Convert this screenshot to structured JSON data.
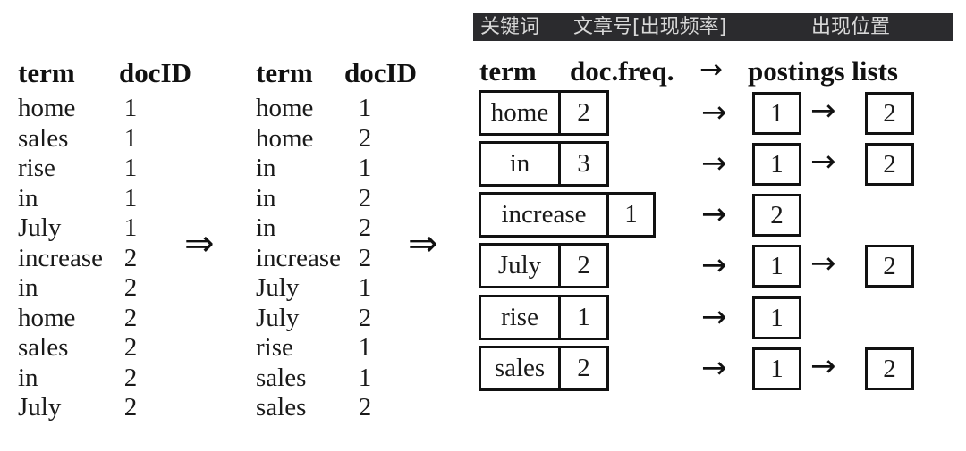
{
  "cn_header": {
    "keyword_label": "关键词",
    "docfreq_label": "文章号[出现频率]",
    "position_label": "出现位置"
  },
  "table1": {
    "headers": [
      "term",
      "docID"
    ],
    "rows": [
      [
        "home",
        "1"
      ],
      [
        "sales",
        "1"
      ],
      [
        "rise",
        "1"
      ],
      [
        "in",
        "1"
      ],
      [
        "July",
        "1"
      ],
      [
        "increase",
        "2"
      ],
      [
        "in",
        "2"
      ],
      [
        "home",
        "2"
      ],
      [
        "sales",
        "2"
      ],
      [
        "in",
        "2"
      ],
      [
        "July",
        "2"
      ]
    ]
  },
  "transform_arrow": "⇒",
  "table2": {
    "headers": [
      "term",
      "docID"
    ],
    "rows": [
      [
        "home",
        "1"
      ],
      [
        "home",
        "2"
      ],
      [
        "in",
        "1"
      ],
      [
        "in",
        "2"
      ],
      [
        "in",
        "2"
      ],
      [
        "increase",
        "2"
      ],
      [
        "July",
        "1"
      ],
      [
        "July",
        "2"
      ],
      [
        "rise",
        "1"
      ],
      [
        "sales",
        "1"
      ],
      [
        "sales",
        "2"
      ]
    ]
  },
  "index": {
    "header_term": "term",
    "header_docfreq": "doc.freq.",
    "header_arrow": "→",
    "header_postings": "postings lists",
    "pointer_arrow": "→",
    "entries": [
      {
        "term": "home",
        "freq": "2",
        "postings": [
          "1",
          "2"
        ]
      },
      {
        "term": "in",
        "freq": "3",
        "postings": [
          "1",
          "2"
        ]
      },
      {
        "term": "increase",
        "freq": "1",
        "postings": [
          "2"
        ]
      },
      {
        "term": "July",
        "freq": "2",
        "postings": [
          "1",
          "2"
        ]
      },
      {
        "term": "rise",
        "freq": "1",
        "postings": [
          "1"
        ]
      },
      {
        "term": "sales",
        "freq": "2",
        "postings": [
          "1",
          "2"
        ]
      }
    ]
  }
}
